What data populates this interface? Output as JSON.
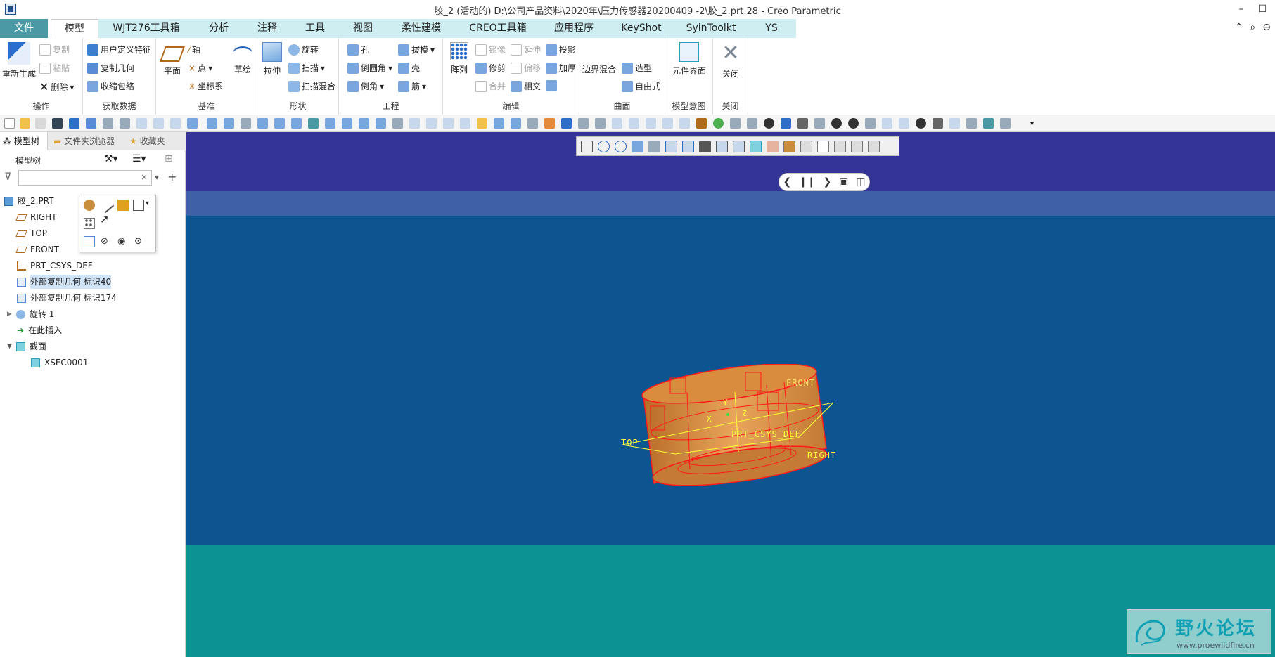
{
  "window": {
    "title": "胶_2 (活动的) D:\\公司产品资料\\2020年\\压力传感器20200409 -2\\胶_2.prt.28 - Creo Parametric",
    "controls": [
      "–",
      "☐"
    ]
  },
  "tabs": [
    {
      "label": "文件"
    },
    {
      "label": "模型"
    },
    {
      "label": "WJT276工具箱"
    },
    {
      "label": "分析"
    },
    {
      "label": "注释"
    },
    {
      "label": "工具"
    },
    {
      "label": "视图"
    },
    {
      "label": "柔性建模"
    },
    {
      "label": "CREO工具箱"
    },
    {
      "label": "应用程序"
    },
    {
      "label": "KeyShot"
    },
    {
      "label": "SyinToolkt"
    },
    {
      "label": "YS"
    }
  ],
  "ribbon": {
    "groups": {
      "operation": {
        "label": "操作",
        "regen": "重新生成",
        "copy": "复制",
        "paste": "粘贴",
        "delete": "删除"
      },
      "getdata": {
        "label": "获取数据",
        "udf": "用户定义特征",
        "copygeom": "复制几何",
        "shrinkwrap": "收缩包络"
      },
      "datum": {
        "label": "基准",
        "plane": "平面",
        "axis": "轴",
        "point": "点",
        "csys": "坐标系",
        "sketch": "草绘"
      },
      "shape": {
        "label": "形状",
        "extrude": "拉伸",
        "revolve": "旋转",
        "sweep": "扫描",
        "swept_blend": "扫描混合"
      },
      "engineering": {
        "label": "工程",
        "hole": "孔",
        "round": "倒圆角",
        "chamfer": "倒角",
        "draft": "拔模",
        "shell": "壳",
        "rib": "筋"
      },
      "editing": {
        "label": "编辑",
        "pattern": "阵列",
        "mirror": "镜像",
        "extend": "延伸",
        "project": "投影",
        "trim": "修剪",
        "offset": "偏移",
        "thicken": "加厚",
        "merge": "合并",
        "intersect": "相交"
      },
      "surfaces": {
        "label": "曲面",
        "boundary_blend": "边界混合",
        "style": "造型",
        "freestyle": "自由式"
      },
      "intent": {
        "label": "模型意图",
        "component_interface": "元件界面"
      },
      "close": {
        "label": "关闭",
        "close": "关闭"
      }
    }
  },
  "panel": {
    "tabs": [
      "模型树",
      "文件夹浏览器",
      "收藏夹"
    ],
    "header": "模型树",
    "filter_value": "",
    "tree": [
      {
        "label": "胶_2.PRT",
        "icon": "part-icon"
      },
      {
        "label": "RIGHT",
        "icon": "datum-plane-icon"
      },
      {
        "label": "TOP",
        "icon": "datum-plane-icon"
      },
      {
        "label": "FRONT",
        "icon": "datum-plane-icon"
      },
      {
        "label": "PRT_CSYS_DEF",
        "icon": "csys-icon"
      },
      {
        "label": "外部复制几何 标识40",
        "icon": "copy-geom-icon",
        "selected": true
      },
      {
        "label": "外部复制几何 标识174",
        "icon": "copy-geom-icon"
      },
      {
        "label": "旋转 1",
        "icon": "revolve-icon"
      },
      {
        "label": "在此插入",
        "icon": "insert-arrow-icon"
      },
      {
        "label": "截面",
        "icon": "section-icon"
      },
      {
        "label": "XSEC0001",
        "icon": "xsec-icon"
      }
    ]
  },
  "viewport": {
    "labels": {
      "top": "TOP",
      "right": "RIGHT",
      "front": "FRONT",
      "csys": "PRT_CSYS_DEF",
      "x": "X",
      "y": "Y",
      "z": "Z"
    }
  },
  "watermark": {
    "title": "野火论坛",
    "url": "www.proewildfire.cn"
  },
  "colors": {
    "accent": "#4a9aa5",
    "tab_bg": "#cfeef2",
    "viewport_top": "#343396",
    "viewport_mid": "#0d5590",
    "viewport_floor": "#0b9393",
    "model": "#e5a04a",
    "model_edges": "#ff1b1b"
  }
}
